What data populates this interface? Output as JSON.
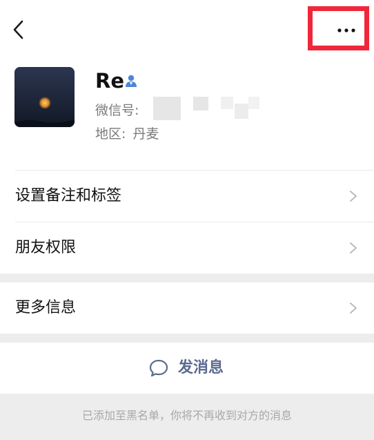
{
  "header": {
    "back_icon": "chevron-left-icon",
    "more_icon": "more-horizontal-icon",
    "highlight_color": "#f0273a"
  },
  "profile": {
    "name": "Re",
    "verified_icon": "person-badge-icon",
    "wechat_id_label": "微信号:",
    "region_label": "地区:",
    "region_value": "丹麦"
  },
  "menu": {
    "items": [
      {
        "label": "设置备注和标签",
        "icon": "chevron-right-icon"
      },
      {
        "label": "朋友权限",
        "icon": "chevron-right-icon"
      },
      {
        "label": "更多信息",
        "icon": "chevron-right-icon"
      }
    ]
  },
  "actions": {
    "send_message_label": "发消息",
    "send_message_icon": "chat-bubble-icon",
    "accent_color": "#5b6a91"
  },
  "footer": {
    "blacklist_notice": "已添加至黑名单，你将不再收到对方的消息"
  }
}
